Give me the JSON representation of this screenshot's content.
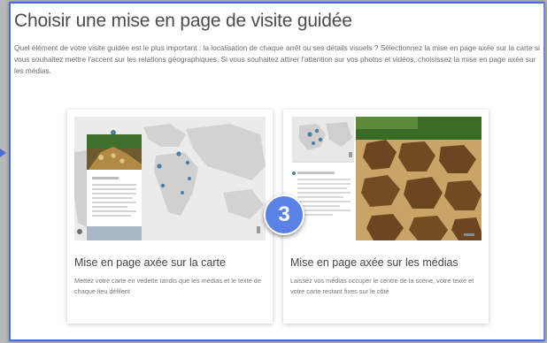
{
  "page": {
    "title": "Choisir une mise en page de visite guidée",
    "description": "Quel élément de votre visite guidée est le plus important : la localisation de chaque arrêt ou ses détails visuels ? Sélectionnez la mise en page axée sur la carte si vous souhaitez mettre l'accent sur les relations géographiques. Si vous souhaitez attirer l'attention sur vos photos et vidéos, choisissez la mise en page axée sur les médias."
  },
  "layouts": [
    {
      "title": "Mise en page axée sur la carte",
      "description": "Mettez votre carte en vedette tandis que les médias et le texte de chaque lieu défilent"
    },
    {
      "title": "Mise en page axée sur les médias",
      "description": "Laissez vos médias occuper le centre de la scène, votre texte et votre carte restant fixes sur le côté"
    }
  ],
  "step_badge": {
    "label": "3"
  },
  "colors": {
    "accent": "#4a6fd8",
    "badge": "#5a82e6",
    "map_land": "#d0d0d0",
    "map_water": "#e8e8e8",
    "marker": "#4a7fa8"
  }
}
